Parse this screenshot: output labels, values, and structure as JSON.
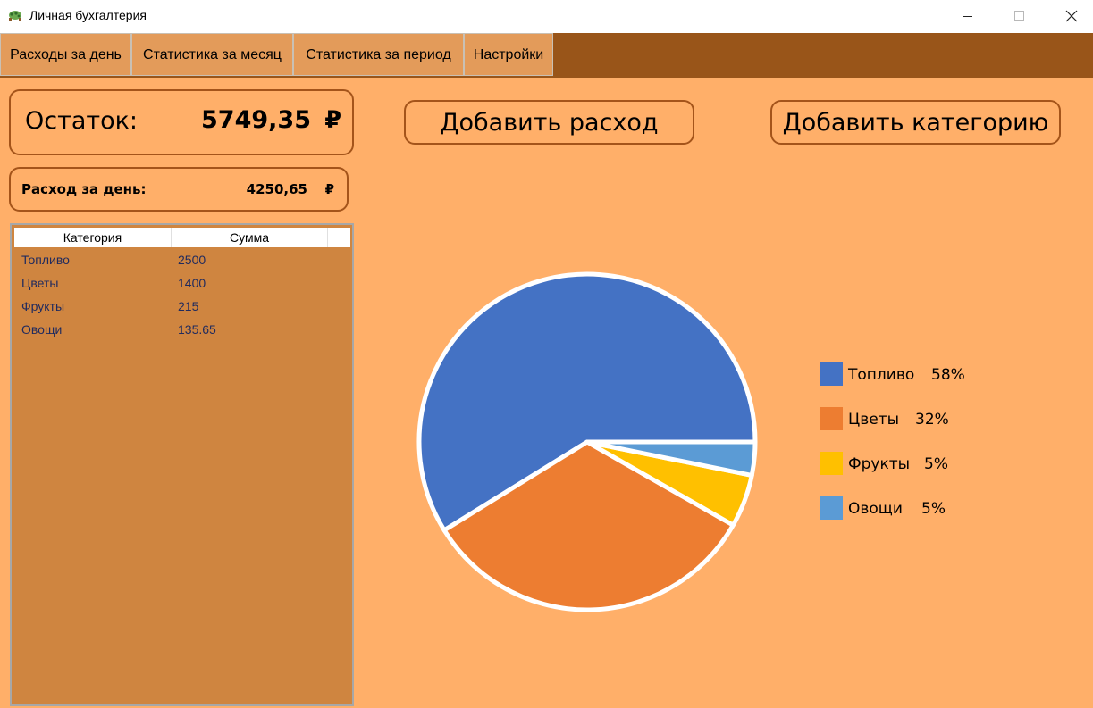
{
  "window": {
    "title": "Личная бухгалтерия"
  },
  "tabs": [
    {
      "label": "Расходы за день"
    },
    {
      "label": "Статистика за месяц"
    },
    {
      "label": "Статистика за период"
    },
    {
      "label": "Настройки"
    }
  ],
  "balance": {
    "label": "Остаток:",
    "amount": "5749,35",
    "currency": "₽"
  },
  "daily": {
    "label": "Расход за день:",
    "amount": "4250,65",
    "currency": "₽"
  },
  "buttons": {
    "add_expense": "Добавить расход",
    "add_category": "Добавить категорию"
  },
  "grid": {
    "columns": [
      "Категория",
      "Сумма"
    ],
    "rows": [
      {
        "category": "Топливо",
        "sum": "2500"
      },
      {
        "category": "Цветы",
        "sum": "1400"
      },
      {
        "category": "Фрукты",
        "sum": "215"
      },
      {
        "category": "Овощи",
        "sum": "135.65"
      }
    ]
  },
  "chart_data": {
    "type": "pie",
    "categories": [
      "Топливо",
      "Цветы",
      "Фрукты",
      "Овощи"
    ],
    "values": [
      2500,
      1400,
      215,
      135.65
    ],
    "percent_labels": [
      "58%",
      "32%",
      "5%",
      "5%"
    ],
    "colors": [
      "#4472c4",
      "#ed7d31",
      "#ffc000",
      "#5b9bd5"
    ],
    "legend_position": "right"
  }
}
